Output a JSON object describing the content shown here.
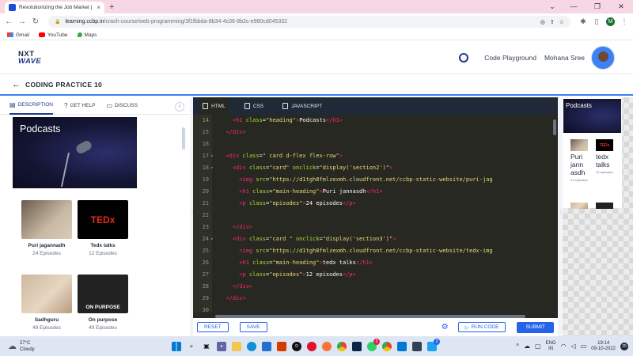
{
  "browser": {
    "tab_title": "Revolutionizing the Job Market |",
    "tab_close": "×",
    "new_tab": "+",
    "url_host": "learning.ccbp.in",
    "url_path": "/crash-course/web-programming/3f1fbbda-8b34-4c06-8b2c-e980cd045332",
    "profile_initial": "M",
    "bookmarks": [
      "Gmail",
      "YouTube",
      "Maps"
    ]
  },
  "header": {
    "logo_line1": "NXT",
    "logo_line2": "WAVE",
    "code_playground": "Code Playground",
    "user_name": "Mohana Sree"
  },
  "practice": {
    "back": "←",
    "title": "CODING PRACTICE 10"
  },
  "left_panel": {
    "tabs": [
      "DESCRIPTION",
      "GET HELP",
      "DISCUSS"
    ],
    "banner_title": "Podcasts",
    "cards": [
      {
        "name": "Puri jagannadh",
        "episodes": "24 Episodes"
      },
      {
        "name": "Tedx talks",
        "episodes": "12 Episodes"
      },
      {
        "name": "Sadhguru",
        "episodes": "49 Episodes"
      },
      {
        "name": "On purpose",
        "episodes": "49 Episodes"
      }
    ],
    "ted_logo": "TEDx",
    "onpurpose_logo": "ON PURPOSE"
  },
  "editor": {
    "tabs": [
      "HTML",
      "CSS",
      "JAVASCRIPT"
    ],
    "lines": [
      {
        "n": "14",
        "fold": "",
        "html": "    <span class='tag'>&lt;h1</span> <span class='attr'>class</span>=<span class='str'>\"heading\"</span><span class='tag'>&gt;</span>Podcasts<span class='tag'>&lt;/h1&gt;</span>"
      },
      {
        "n": "15",
        "fold": "",
        "html": "  <span class='tag'>&lt;/div&gt;</span>"
      },
      {
        "n": "16",
        "fold": "",
        "html": ""
      },
      {
        "n": "17",
        "fold": "▾",
        "html": "  <span class='tag'>&lt;div</span> <span class='attr'>class</span>=<span class='str'>\" card d-flex flex-row\"</span><span class='tag'>&gt;</span>"
      },
      {
        "n": "18",
        "fold": "▾",
        "html": "    <span class='tag'>&lt;div</span> <span class='attr'>class</span>=<span class='str'>\"card\"</span> <span class='attr'>onclick</span>=<span class='str'>\"display('section2')\"</span><span class='tag'>&gt;</span>"
      },
      {
        "n": "19",
        "fold": "",
        "html": "      <span class='tag'>&lt;img</span> <span class='attr'>src</span>=<span class='str'>\"https://d1tgh8fmlzexmh.cloudfront.net/ccbp-static-website/puri-jag</span>"
      },
      {
        "n": "20",
        "fold": "",
        "html": "      <span class='tag'>&lt;h1</span> <span class='attr'>class</span>=<span class='str'>\"main-heading\"</span><span class='tag'>&gt;</span>Puri jannasdh<span class='tag'>&lt;/h1&gt;</span>"
      },
      {
        "n": "21",
        "fold": "",
        "html": "      <span class='tag'>&lt;p</span> <span class='attr'>class</span>=<span class='str'>\"episodes\"</span><span class='tag'>&gt;</span>24 episodes<span class='tag'>&lt;/p&gt;</span>"
      },
      {
        "n": "22",
        "fold": "",
        "html": ""
      },
      {
        "n": "23",
        "fold": "",
        "html": "    <span class='tag'>&lt;/div&gt;</span>"
      },
      {
        "n": "24",
        "fold": "▾",
        "html": "    <span class='tag'>&lt;div</span> <span class='attr'>class</span>=<span class='str'>\"card \"</span> <span class='attr'>onclick</span>=<span class='str'>\"display('section3')\"</span><span class='tag'>&gt;</span>"
      },
      {
        "n": "25",
        "fold": "",
        "html": "      <span class='tag'>&lt;img</span> <span class='attr'>src</span>=<span class='str'>\"https://d1tgh8fmlzexmh.cloudfront.net/ccbp-static-website/tedx-img</span>"
      },
      {
        "n": "26",
        "fold": "",
        "html": "      <span class='tag'>&lt;h1</span> <span class='attr'>class</span>=<span class='str'>\"main-heading\"</span><span class='tag'>&gt;</span>tedx talks<span class='tag'>&lt;/h1&gt;</span>"
      },
      {
        "n": "27",
        "fold": "",
        "html": "      <span class='tag'>&lt;p</span> <span class='attr'>class</span>=<span class='str'>\"episodes\"</span><span class='tag'>&gt;</span>12 episodes<span class='tag'>&lt;/p&gt;</span>"
      },
      {
        "n": "28",
        "fold": "",
        "html": "    <span class='tag'>&lt;/div&gt;</span>"
      },
      {
        "n": "29",
        "fold": "",
        "html": "  <span class='tag'>&lt;/div&gt;</span>"
      },
      {
        "n": "30",
        "fold": "",
        "html": ""
      }
    ]
  },
  "actions": {
    "reset": "RESET",
    "save": "SAVE",
    "run_code": "RUN CODE",
    "submit": "SUBMIT"
  },
  "preview": {
    "banner_title": "Podcasts",
    "card1_name": "Puri jann asdh",
    "card1_eps": "24 episodes",
    "card2_name": "tedx talks",
    "card2_eps": "12 episodes",
    "ted_logo": "TEDx"
  },
  "taskbar": {
    "temp": "27°C",
    "condition": "Cloudy",
    "lang1": "ENG",
    "lang2": "IN",
    "time": "19:14",
    "date": "09-10-2022",
    "badge": "25",
    "badge_whatsapp": "2",
    "badge_twitter": "2"
  },
  "colors": {
    "accent": "#2563eb",
    "editor_bg": "#272822",
    "tab_bar": "#f7d7e3"
  }
}
